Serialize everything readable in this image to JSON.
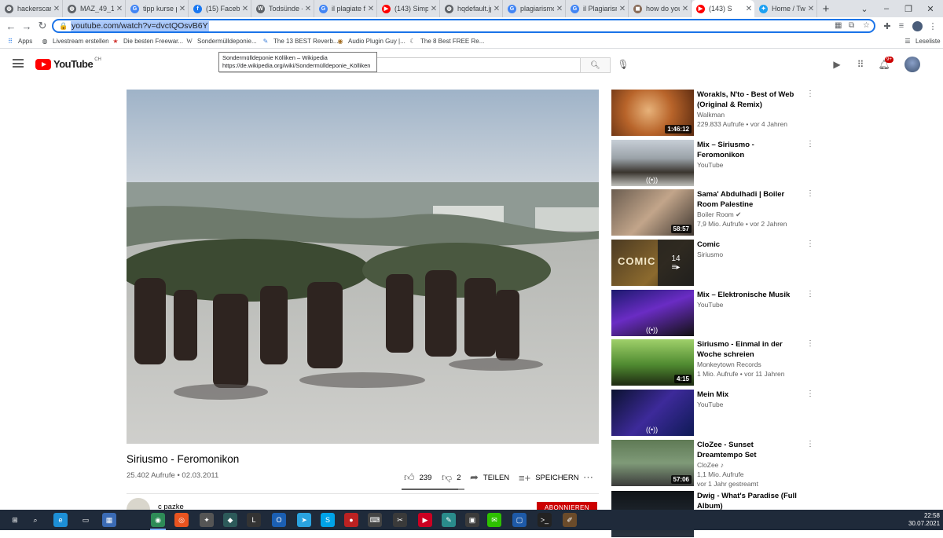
{
  "browser": {
    "tabs": [
      {
        "title": "hackerscard",
        "favicon": "globe-icon",
        "color": "#5f6368"
      },
      {
        "title": "MAZ_49_19",
        "favicon": "globe-icon",
        "color": "#5f6368"
      },
      {
        "title": "tipp kurse p",
        "favicon": "google-icon",
        "color": "#4285f4"
      },
      {
        "title": "(15) Facebo",
        "favicon": "facebook-icon",
        "color": "#1877f2"
      },
      {
        "title": "Todsünde -",
        "favicon": "wikipedia-icon",
        "color": "#5f6368"
      },
      {
        "title": "il plagiate f",
        "favicon": "google-icon",
        "color": "#4285f4"
      },
      {
        "title": "(143) Simp",
        "favicon": "youtube-icon",
        "color": "#ff0000"
      },
      {
        "title": "hqdefault.jp",
        "favicon": "globe-icon",
        "color": "#5f6368"
      },
      {
        "title": "plagiarismo",
        "favicon": "google-icon",
        "color": "#4285f4"
      },
      {
        "title": "il Plagiarism",
        "favicon": "google-icon",
        "color": "#4285f4"
      },
      {
        "title": "how do you",
        "favicon": "image-icon",
        "color": "#8a6d5a"
      },
      {
        "title": "(143) S",
        "favicon": "youtube-icon",
        "color": "#ff0000"
      },
      {
        "title": "Home / Twit",
        "favicon": "twitter-icon",
        "color": "#1da1f2"
      }
    ],
    "new_tab_label": "+",
    "url_highlight": "youtube.com/watch?v=dvctQOsvB6Y",
    "bookmarks": [
      {
        "label": "Apps",
        "icon": "apps-grid-icon"
      },
      {
        "label": "Livestream erstellen",
        "icon": "globe-icon"
      },
      {
        "label": "Die besten Freewar...",
        "icon": "star-icon"
      },
      {
        "label": "Sondermülldeponie...",
        "icon": "wikipedia-icon"
      },
      {
        "label": "The 13 BEST Reverb...",
        "icon": "feather-icon"
      },
      {
        "label": "Audio Plugin Guy |...",
        "icon": "plugin-icon"
      },
      {
        "label": "The 8 Best FREE Re...",
        "icon": "moon-icon"
      }
    ],
    "reading_list_label": "Leseliste"
  },
  "youtube": {
    "logo_word": "YouTube",
    "logo_region": "CH",
    "search_tooltip_title": "Sondermülldeponie Kölliken – Wikipedia",
    "search_tooltip_url": "https://de.wikipedia.org/wiki/Sondermülldeponie_Kölliken",
    "notification_badge": "9+"
  },
  "video": {
    "title": "Siriusmo - Feromonikon",
    "views": "25.402 Aufrufe",
    "date": "02.03.2011",
    "likes": "239",
    "dislikes": "2",
    "share_label": "TEILEN",
    "save_label": "SPEICHERN",
    "channel_name": "c pazke",
    "subscribe_label": "ABONNIEREN"
  },
  "recommendations": [
    {
      "title": "Worakls, N'to - Best of Web (Original & Remix)",
      "channel": "Walkman",
      "meta": "229.833 Aufrufe • vor 4 Jahren",
      "duration": "1:46:12",
      "type": "video"
    },
    {
      "title": "Mix – Siriusmo - Feromonikon",
      "channel": "YouTube",
      "meta": "",
      "duration": "",
      "type": "mix"
    },
    {
      "title": "Sama' Abdulhadi | Boiler Room Palestine",
      "channel": "Boiler Room",
      "meta": "7,9 Mio. Aufrufe • vor 2 Jahren",
      "duration": "58:57",
      "type": "video",
      "verified": true
    },
    {
      "title": "Comic",
      "channel": "Siriusmo",
      "meta": "",
      "duration": "",
      "type": "playlist",
      "count": "14"
    },
    {
      "title": "Mix – Elektronische Musik",
      "channel": "YouTube",
      "meta": "",
      "duration": "",
      "type": "mix"
    },
    {
      "title": "Siriusmo - Einmal in der Woche schreien",
      "channel": "Monkeytown Records",
      "meta": "1 Mio. Aufrufe • vor 11 Jahren",
      "duration": "4:15",
      "type": "video"
    },
    {
      "title": "Mein Mix",
      "channel": "YouTube",
      "meta": "",
      "duration": "",
      "type": "mix"
    },
    {
      "title": "CloZee - Sunset Dreamtempo Set",
      "channel": "CloZee",
      "meta": "1,1 Mio. Aufrufe",
      "meta2": "vor 1 Jahr gestreamt",
      "duration": "57:06",
      "type": "video",
      "music_note": true
    },
    {
      "title": "Dwig - What's Paradise (Full Album)",
      "channel": "",
      "meta": "",
      "duration": "",
      "type": "video"
    }
  ],
  "taskbar": {
    "time": "22:58",
    "date": "30.07.2021"
  }
}
